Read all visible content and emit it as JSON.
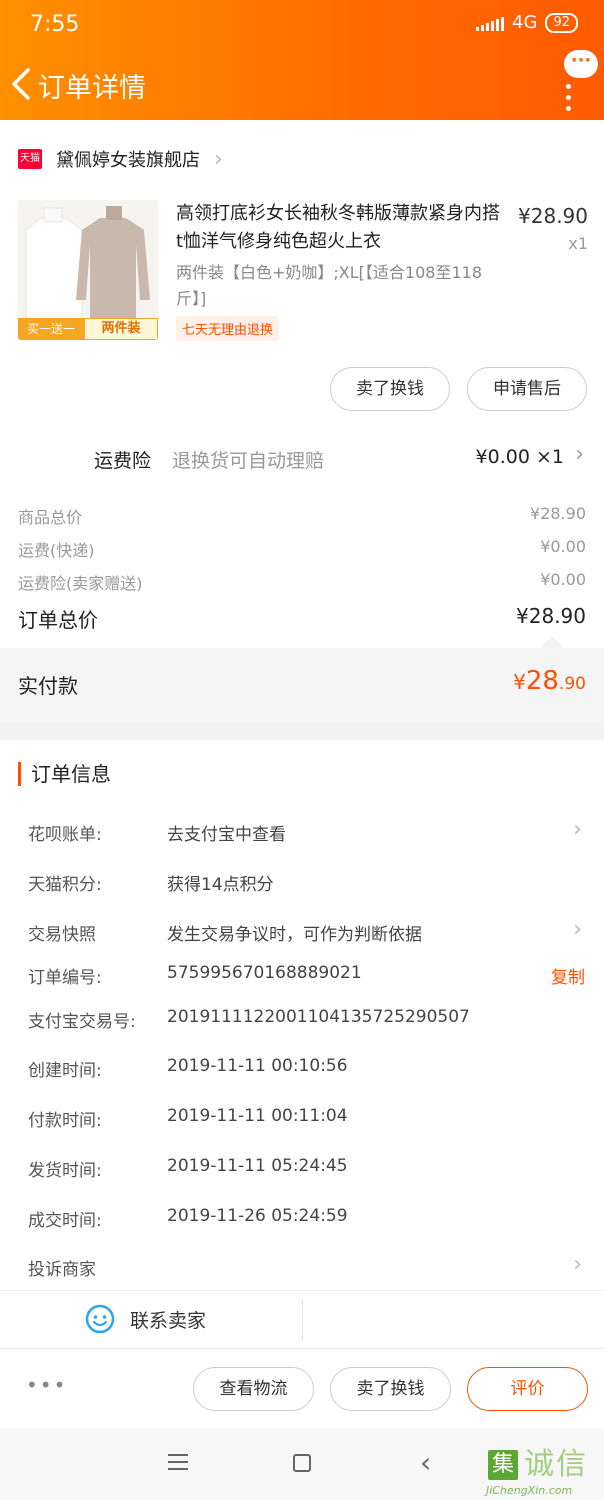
{
  "status_bar": {
    "time": "7:55",
    "network": "4G",
    "battery": "92"
  },
  "nav": {
    "title": "订单详情",
    "chat_icon_glyph": "···"
  },
  "shop": {
    "badge": "天猫",
    "name": "黛佩婷女装旗舰店"
  },
  "product": {
    "title": "高领打底衫女长袖秋冬韩版薄款紧身内搭t恤洋气修身纯色超火上衣",
    "price": "¥28.90",
    "qty": "x1",
    "sku": "两件装【白色+奶咖】;XL[【适合108至118斤】]",
    "return_tag": "七天无理由退换",
    "image_banner_left": "买一送一",
    "image_banner_right": "两件装"
  },
  "product_buttons": {
    "sell": "卖了换钱",
    "after_sale": "申请售后"
  },
  "insurance": {
    "label": "运费险",
    "desc": "退换货可自动理赔",
    "value": "¥0.00 ×1"
  },
  "fees": [
    {
      "label": "商品总价",
      "value": "¥28.90"
    },
    {
      "label": "运费(快递)",
      "value": "¥0.00"
    },
    {
      "label": "运费险(卖家赠送)",
      "value": "¥0.00"
    }
  ],
  "total": {
    "label": "订单总价",
    "value": "¥28.90"
  },
  "paid": {
    "label": "实付款",
    "currency": "¥",
    "int": "28",
    "dec": ".90"
  },
  "order_info": {
    "title": "订单信息",
    "rows": [
      {
        "k": "花呗账单:",
        "v": "去支付宝中查看"
      },
      {
        "k": "天猫积分:",
        "v": "获得14点积分"
      },
      {
        "k": "交易快照",
        "v": "发生交易争议时，可作为判断依据"
      },
      {
        "k": "订单编号:",
        "v": "575995670168889021"
      },
      {
        "k": "支付宝交易号:",
        "v": "2019111122001104135725290507"
      },
      {
        "k": "创建时间:",
        "v": "2019-11-11 00:10:56"
      },
      {
        "k": "付款时间:",
        "v": "2019-11-11 00:11:04"
      },
      {
        "k": "发货时间:",
        "v": "2019-11-11 05:24:45"
      },
      {
        "k": "成交时间:",
        "v": "2019-11-26 05:24:59"
      },
      {
        "k": "投诉商家",
        "v": ""
      }
    ],
    "copy_label": "复制"
  },
  "contact": {
    "label": "联系卖家"
  },
  "actions": {
    "more": "•••",
    "logistics": "查看物流",
    "sell": "卖了换钱",
    "review": "评价"
  },
  "watermark": {
    "box": "集",
    "chars": "诚信",
    "sub": "JiChengXin.com"
  },
  "colors": {
    "brand_orange": "#ff5000",
    "header_start": "#ff9000",
    "header_end": "#ff5b00"
  }
}
